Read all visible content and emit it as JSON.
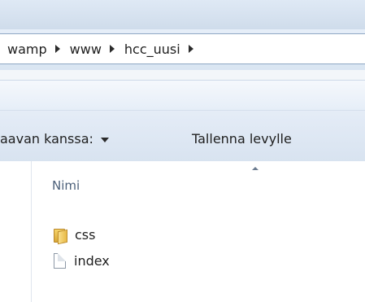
{
  "breadcrumb": {
    "items": [
      {
        "label": "wamp"
      },
      {
        "label": "www"
      },
      {
        "label": "hcc_uusi"
      }
    ]
  },
  "toolbar": {
    "share_label": "aavan kanssa:",
    "burn_label": "Tallenna levylle"
  },
  "file_list": {
    "column_name": "Nimi",
    "sort": "ascending",
    "items": [
      {
        "name": "css",
        "icon": "folder-icon"
      },
      {
        "name": "index",
        "icon": "document-icon"
      }
    ]
  }
}
